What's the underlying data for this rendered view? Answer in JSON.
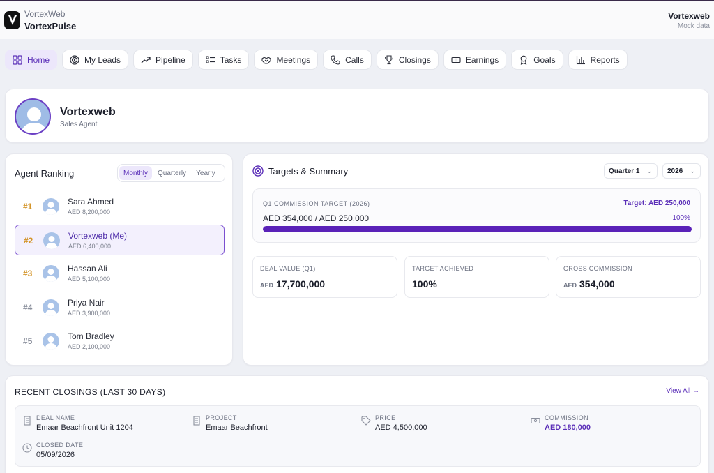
{
  "header": {
    "brand_small": "VortexWeb",
    "brand_big": "VortexPulse",
    "user_name": "Vortexweb",
    "user_sub": "Mock data"
  },
  "nav": [
    {
      "label": "Home",
      "icon": "grid-icon",
      "active": true
    },
    {
      "label": "My Leads",
      "icon": "target-icon"
    },
    {
      "label": "Pipeline",
      "icon": "trending-up-icon"
    },
    {
      "label": "Tasks",
      "icon": "checklist-icon"
    },
    {
      "label": "Meetings",
      "icon": "handshake-icon"
    },
    {
      "label": "Calls",
      "icon": "phone-icon"
    },
    {
      "label": "Closings",
      "icon": "trophy-icon"
    },
    {
      "label": "Earnings",
      "icon": "banknote-icon"
    },
    {
      "label": "Goals",
      "icon": "award-icon"
    },
    {
      "label": "Reports",
      "icon": "bar-chart-icon"
    }
  ],
  "profile": {
    "name": "Vortexweb",
    "role": "Sales Agent"
  },
  "ranking": {
    "title": "Agent Ranking",
    "periods": [
      "Monthly",
      "Quarterly",
      "Yearly"
    ],
    "active_period": "Monthly",
    "agents": [
      {
        "rank": "#1",
        "name": "Sara Ahmed",
        "amount": "AED 8,200,000"
      },
      {
        "rank": "#2",
        "name": "Vortexweb (Me)",
        "amount": "AED 6,400,000",
        "me": true
      },
      {
        "rank": "#3",
        "name": "Hassan Ali",
        "amount": "AED 5,100,000"
      },
      {
        "rank": "#4",
        "name": "Priya Nair",
        "amount": "AED 3,900,000"
      },
      {
        "rank": "#5",
        "name": "Tom Bradley",
        "amount": "AED 2,100,000"
      }
    ]
  },
  "targets": {
    "title": "Targets & Summary",
    "quarter": "Quarter 1",
    "year": "2026",
    "commission_label": "Q1 COMMISSION TARGET (2026)",
    "commission_target": "Target: AED 250,000",
    "commission_value": "AED 354,000 / AED 250,000",
    "commission_pct": "100%",
    "progress": 1.0,
    "stats": [
      {
        "label": "DEAL VALUE (Q1)",
        "currency": "AED",
        "value": "17,700,000"
      },
      {
        "label": "TARGET ACHIEVED",
        "currency": "",
        "value": "100%"
      },
      {
        "label": "GROSS COMMISSION",
        "currency": "AED",
        "value": "354,000"
      }
    ]
  },
  "closings": {
    "title": "RECENT CLOSINGS (LAST 30 DAYS)",
    "view_all": "View All →",
    "deal": {
      "deal_name_label": "DEAL NAME",
      "deal_name": "Emaar Beachfront Unit 1204",
      "project_label": "PROJECT",
      "project": "Emaar Beachfront",
      "price_label": "PRICE",
      "price": "AED 4,500,000",
      "commission_label": "COMMISSION",
      "commission": "AED 180,000",
      "closed_date_label": "CLOSED DATE",
      "closed_date": "05/09/2026"
    }
  },
  "colors": {
    "accent": "#5b2fb8",
    "rank_gold": "#d4952a",
    "rank_gray": "#8a8f9c"
  }
}
